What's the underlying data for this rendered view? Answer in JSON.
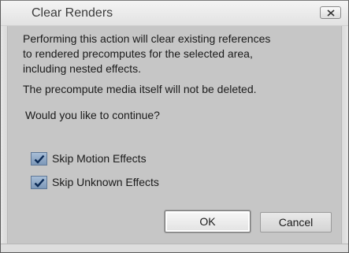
{
  "dialog": {
    "title": "Clear Renders",
    "close_icon": "close-x-icon"
  },
  "message": {
    "line1": "Performing this action will clear existing references",
    "line2": "to rendered precomputes for the selected area,",
    "line3": "including nested effects.",
    "line4": "The precompute media itself will not be deleted.",
    "question": "Would you like to continue?"
  },
  "options": [
    {
      "label": "Skip Motion Effects",
      "checked": true
    },
    {
      "label": "Skip Unknown Effects",
      "checked": true
    }
  ],
  "buttons": {
    "ok_label": "OK",
    "cancel_label": "Cancel"
  },
  "colors": {
    "dialog_background": "#c6c6c6",
    "checkbox_fill": "#8ea7c6",
    "check_mark": "#0b2a55"
  }
}
